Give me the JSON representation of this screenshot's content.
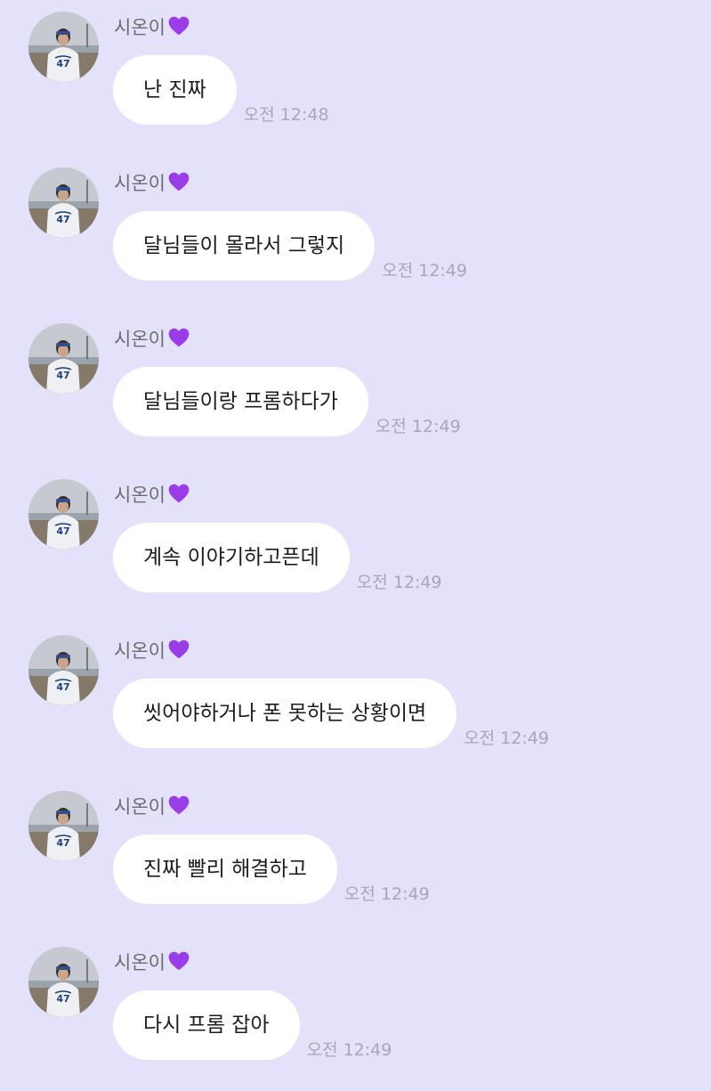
{
  "colors": {
    "background": "#E4E1FA",
    "bubble": "#FFFFFF",
    "heart": "#9A3DE8",
    "timestamp": "#A9A7B3",
    "sender": "#6D6D6D"
  },
  "messages": [
    {
      "sender": "시온이",
      "sender_icon": "purple-heart-icon",
      "text": "난 진짜",
      "time": "오전 12:48"
    },
    {
      "sender": "시온이",
      "sender_icon": "purple-heart-icon",
      "text": "달님들이 몰라서 그렇지",
      "time": "오전 12:49"
    },
    {
      "sender": "시온이",
      "sender_icon": "purple-heart-icon",
      "text": "달님들이랑 프롬하다가",
      "time": "오전 12:49"
    },
    {
      "sender": "시온이",
      "sender_icon": "purple-heart-icon",
      "text": "계속 이야기하고픈데",
      "time": "오전 12:49"
    },
    {
      "sender": "시온이",
      "sender_icon": "purple-heart-icon",
      "text": "씻어야하거나 폰 못하는 상황이면",
      "time": "오전 12:49"
    },
    {
      "sender": "시온이",
      "sender_icon": "purple-heart-icon",
      "text": "진짜 빨리 해결하고",
      "time": "오전 12:49"
    },
    {
      "sender": "시온이",
      "sender_icon": "purple-heart-icon",
      "text": "다시 프롬 잡아",
      "time": "오전 12:49"
    }
  ]
}
